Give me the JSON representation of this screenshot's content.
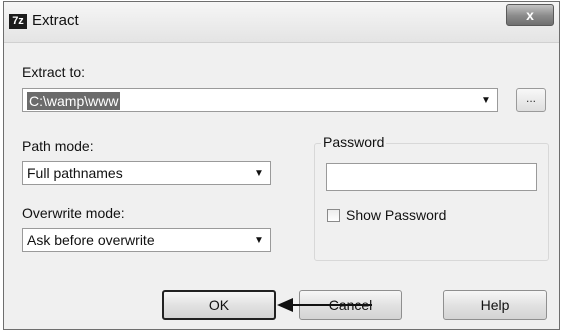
{
  "window": {
    "title": "Extract",
    "app_icon_text": "7z",
    "close_label": "x"
  },
  "extract_to": {
    "label": "Extract to:",
    "value": "C:\\wamp\\www",
    "browse_label": "..."
  },
  "path_mode": {
    "label": "Path mode:",
    "selected": "Full pathnames"
  },
  "overwrite_mode": {
    "label": "Overwrite mode:",
    "selected": "Ask before overwrite"
  },
  "password": {
    "group_label": "Password",
    "value": "",
    "show_password_label": "Show Password",
    "show_password_checked": false
  },
  "buttons": {
    "ok": "OK",
    "cancel": "Cancel",
    "help": "Help"
  },
  "colors": {
    "dialog_bg": "#f0f0f0",
    "selection_bg": "#6b6b6b",
    "annotation_arrow": "#111111"
  },
  "icons": [
    "app-7zip-icon",
    "close-icon",
    "dropdown-arrow-icon",
    "annotation-arrow-icon"
  ]
}
